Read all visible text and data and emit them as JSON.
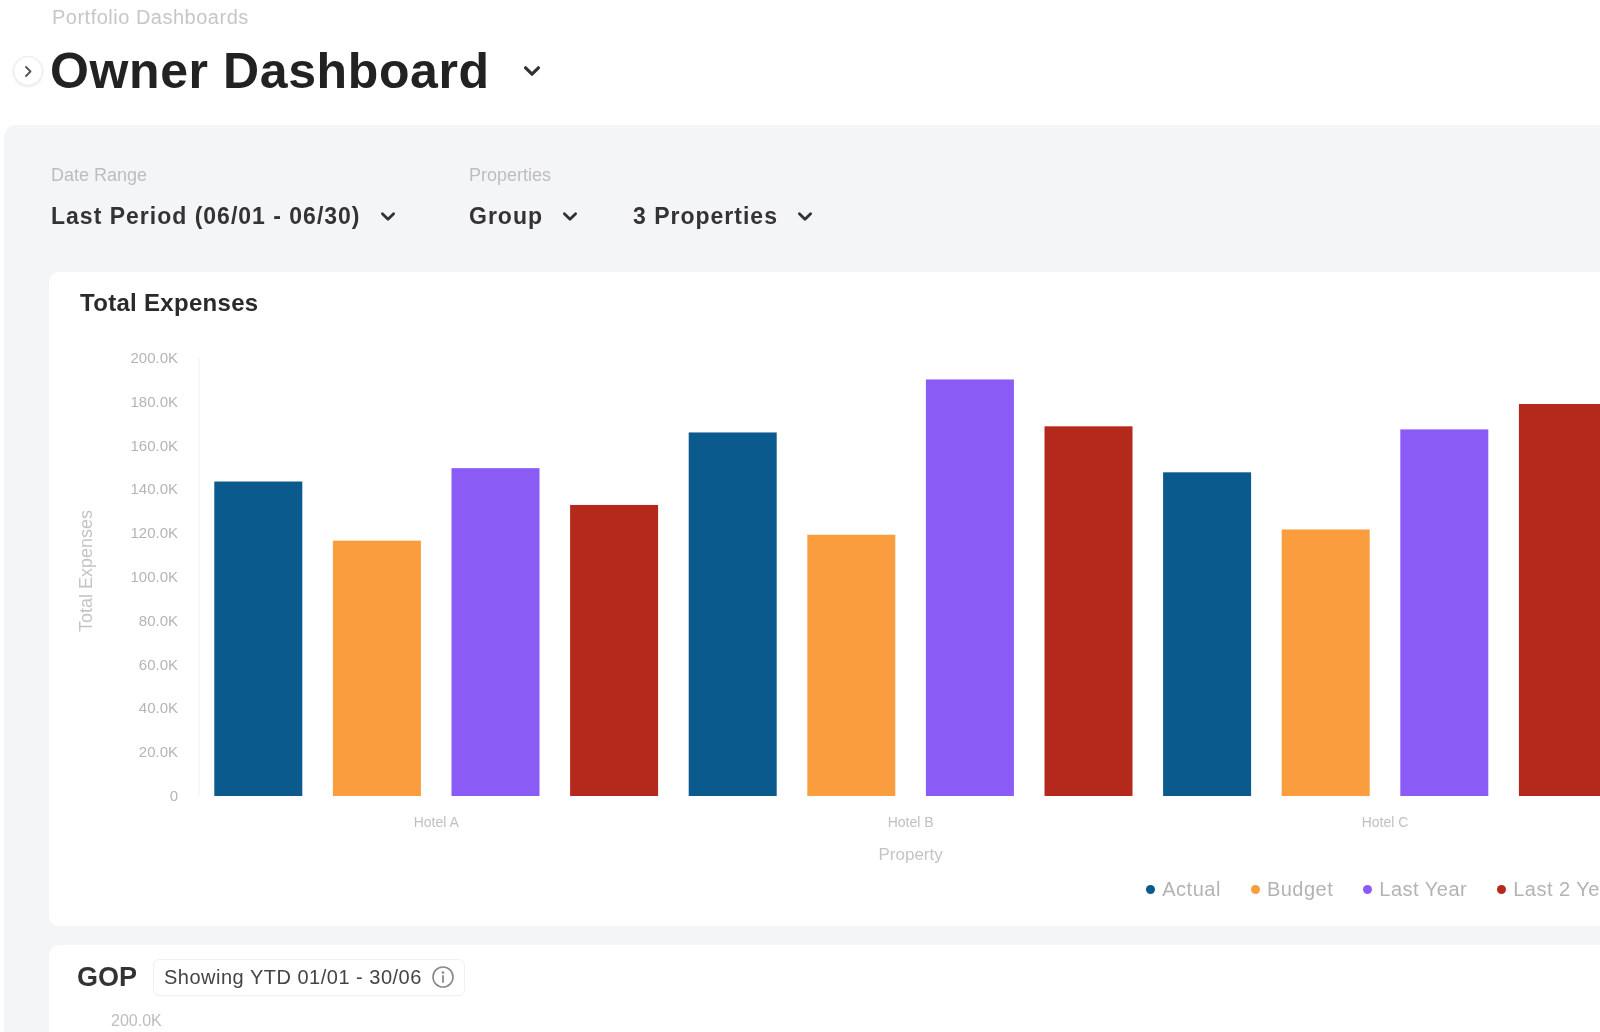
{
  "breadcrumb": "Portfolio Dashboards",
  "title": "Owner Dashboard",
  "filters": [
    {
      "label": "Date Range",
      "dropdowns": [
        "Last Period (06/01 - 06/30)"
      ]
    },
    {
      "label": "Properties",
      "dropdowns": [
        "Group",
        "3 Properties"
      ]
    }
  ],
  "total_expenses": {
    "title": "Total Expenses",
    "chart_data": {
      "type": "bar",
      "xlabel": "Property",
      "ylabel": "Total Expenses",
      "categories": [
        "Hotel A",
        "Hotel B",
        "Hotel C"
      ],
      "series": [
        {
          "name": "Actual",
          "color": "#0b5a8e",
          "values": [
            143600,
            166000,
            147800
          ]
        },
        {
          "name": "Budget",
          "color": "#fa9d3f",
          "values": [
            116600,
            119300,
            121700
          ]
        },
        {
          "name": "Last Year",
          "color": "#8a5cf5",
          "values": [
            149700,
            190200,
            167400
          ]
        },
        {
          "name": "Last 2 Ye",
          "color": "#b5291d",
          "values": [
            132900,
            168800,
            179000
          ]
        }
      ],
      "ylim": [
        0,
        200000
      ],
      "yticks": [
        0,
        {
          "value": 20000,
          "label": "20.0K"
        },
        {
          "value": 40000,
          "label": "40.0K"
        },
        {
          "value": 60000,
          "label": "60.0K"
        },
        {
          "value": 80000,
          "label": "80.0K"
        },
        {
          "value": 100000,
          "label": "100.0K"
        },
        {
          "value": 120000,
          "label": "120.0K"
        },
        {
          "value": 140000,
          "label": "140.0K"
        },
        {
          "value": 160000,
          "label": "160.0K"
        },
        {
          "value": 180000,
          "label": "180.0K"
        },
        {
          "value": 200000,
          "label": "200.0K"
        }
      ],
      "legend": true
    }
  },
  "gop": {
    "title": "GOP",
    "period_chip": "Showing YTD 01/01 - 30/06",
    "y_tick": "200.0K"
  }
}
